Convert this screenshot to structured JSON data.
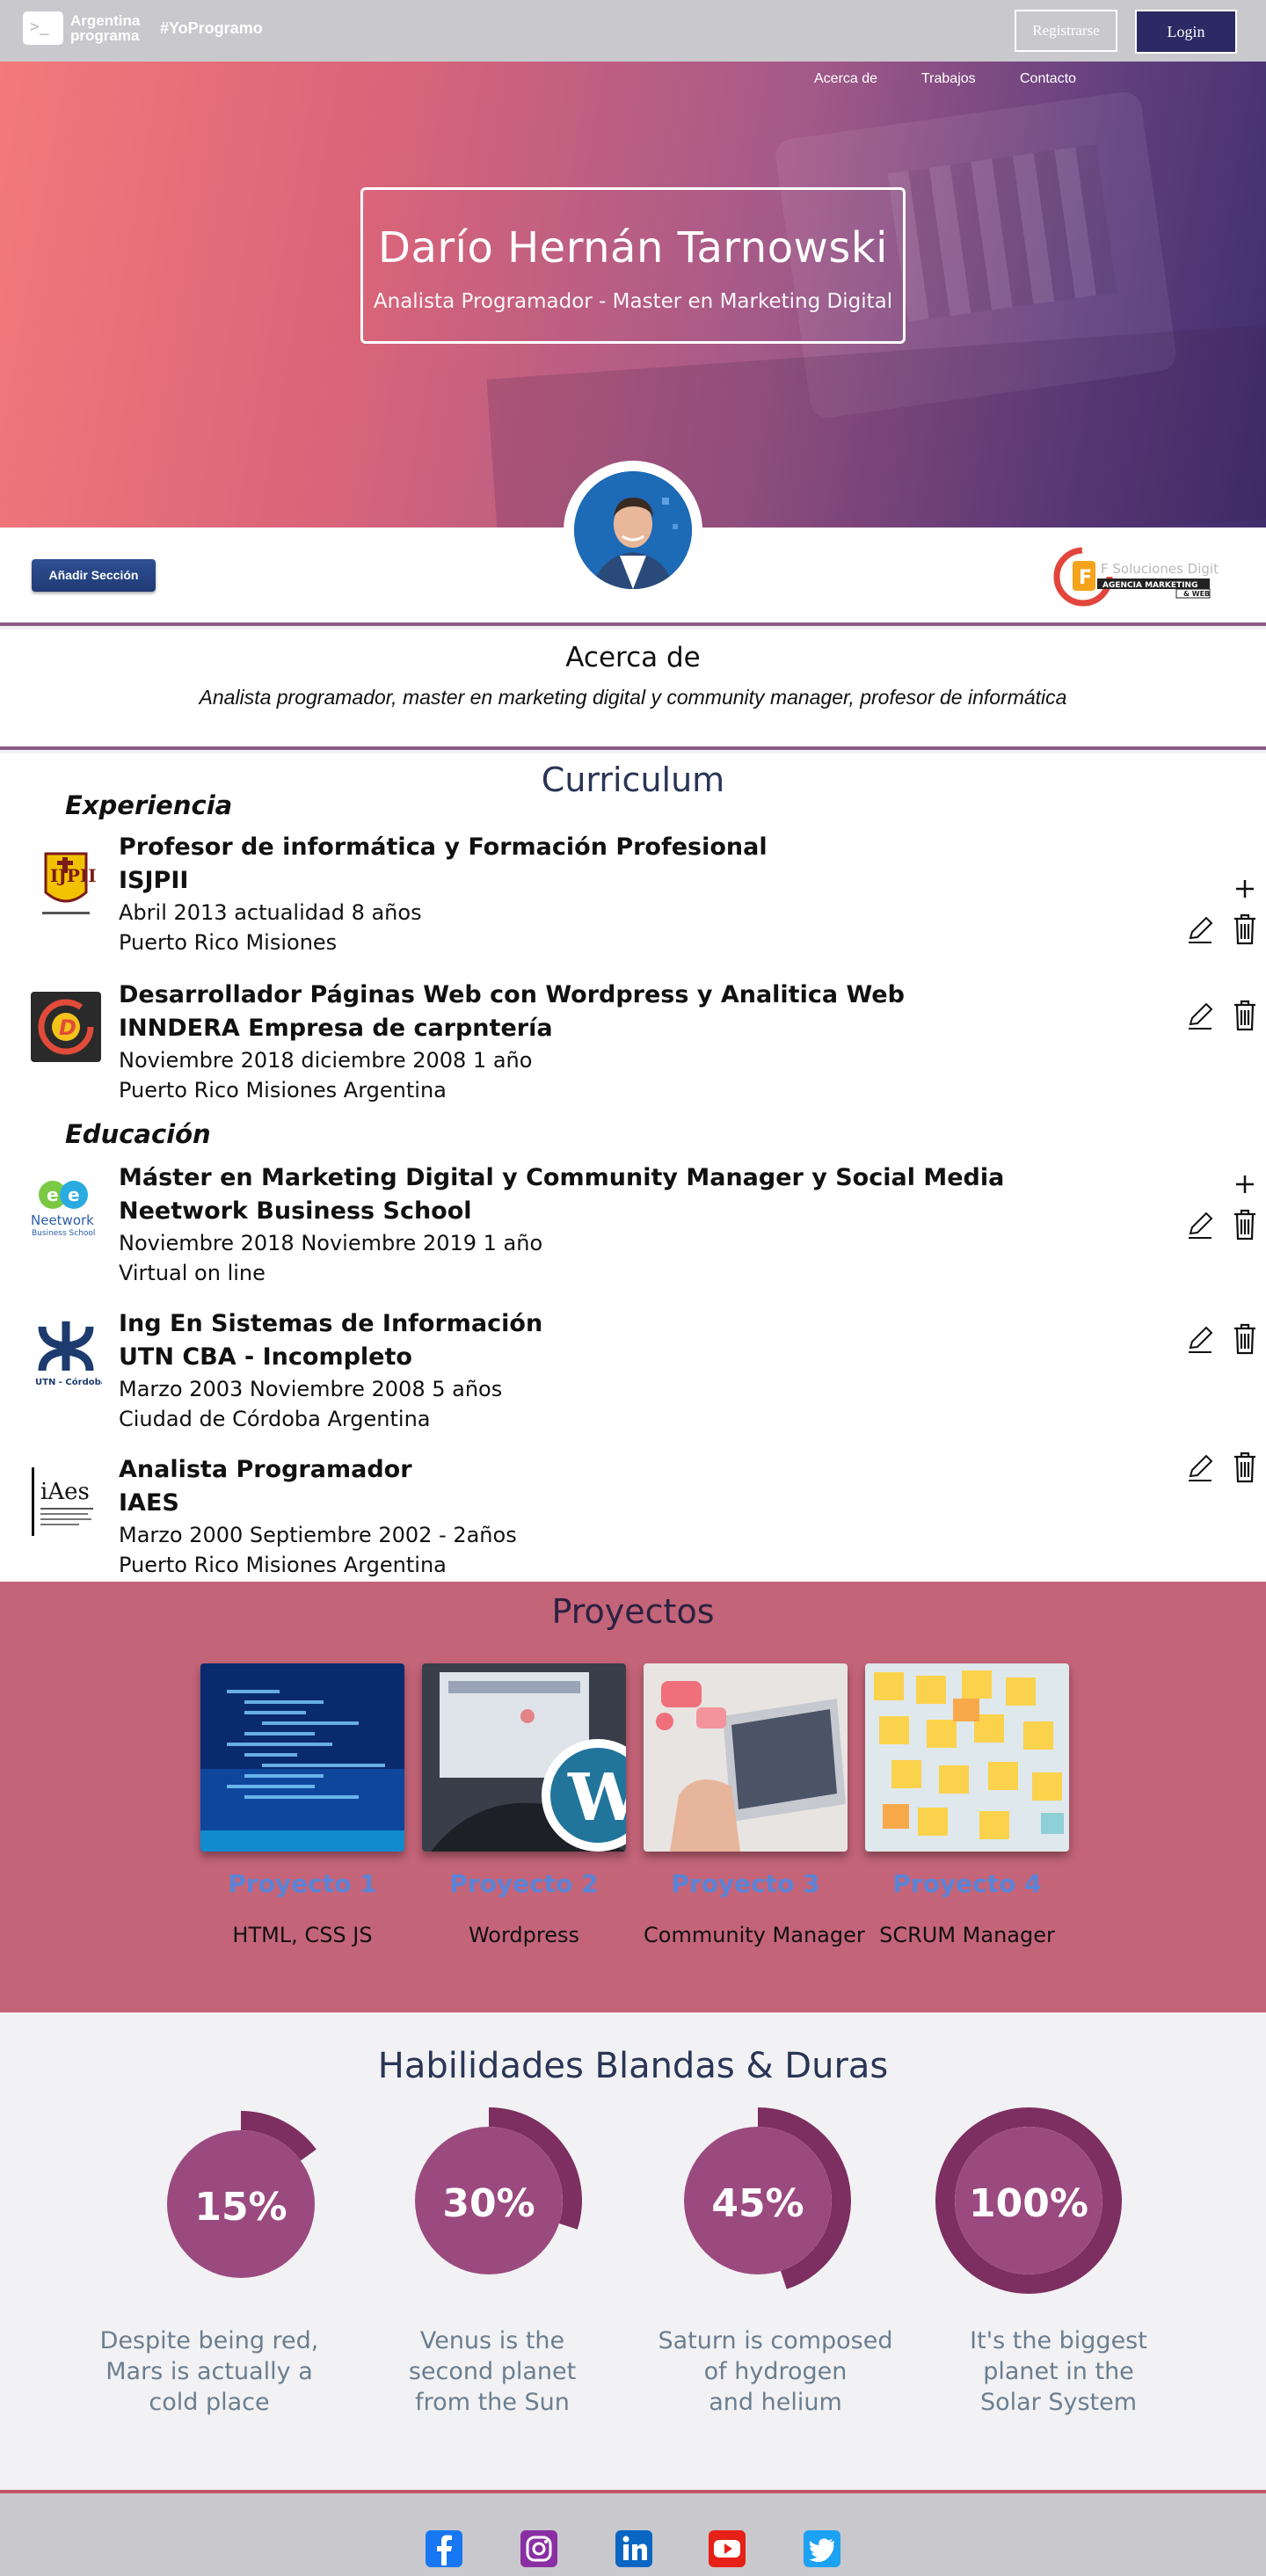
{
  "topbar": {
    "brand_line1": "Argentina",
    "brand_line2": "programa",
    "prompt_glyph": ">_",
    "hashtag": "#YoProgramo",
    "register_label": "Registrarse",
    "login_label": "Login"
  },
  "hero": {
    "nav": [
      "Acerca de",
      "Trabajos",
      "Contacto"
    ],
    "name": "Darío Hernán Tarnowski",
    "subtitle": "Analista Programador  - Master en  Marketing Digital"
  },
  "profile": {
    "add_section_label": "Añadir Sección",
    "sponsor_text_line1": "F Soluciones Digitales",
    "sponsor_text_line2": "AGENCIA MARKETING",
    "sponsor_text_line3": "& WEB"
  },
  "about": {
    "title": "Acerca de",
    "text": "Analista programador, master en marketing digital y community manager,  profesor de informática"
  },
  "curriculum": {
    "title": "Curriculum",
    "experience_heading": "Experiencia",
    "education_heading": "Educación",
    "experience": [
      {
        "title": "Profesor de informática  y Formación Profesional",
        "org": "ISJPII",
        "period": "Abril 2013  actualidad 8 años",
        "place": "Puerto Rico Misiones",
        "logo_text": "IJPII"
      },
      {
        "title": "Desarrollador Páginas Web con Wordpress y Analitica Web",
        "org": "INNDERA Empresa de carpntería",
        "period": "Noviembre 2018  diciembre 2008 1 año",
        "place": "Puerto Rico Misiones Argentina",
        "logo_text": "D"
      }
    ],
    "education": [
      {
        "title": "Máster en Marketing Digital y Community Manager y Social Media",
        "org": "Neetwork Business School",
        "period": "Noviembre  2018  Noviembre 2019 1 año",
        "place": "Virtual on line",
        "logo_text": "Neetwork",
        "logo_sub": "Business School"
      },
      {
        "title": "Ing En Sistemas de Información",
        "org": "UTN CBA - Incompleto",
        "period": "Marzo  2003  Noviembre 2008 5 años",
        "place": "Ciudad de Córdoba  Argentina",
        "logo_text": "UTN - Córdoba"
      },
      {
        "title": "Analista Programador",
        "org": "IAES",
        "period": "Marzo  2000  Septiembre 2002 - 2años",
        "place": "Puerto Rico Misiones Argentina",
        "logo_text": "iAes"
      }
    ]
  },
  "projects": {
    "title": "Proyectos",
    "items": [
      {
        "title": "Proyecto 1",
        "desc": "HTML, CSS JS"
      },
      {
        "title": "Proyecto 2",
        "desc": "Wordpress"
      },
      {
        "title": "Proyecto 3",
        "desc": "Community Manager"
      },
      {
        "title": "Proyecto  4",
        "desc": "SCRUM Manager"
      }
    ]
  },
  "skills": {
    "title": "Habilidades  Blandas & Duras",
    "items": [
      {
        "label": "15%",
        "value": 0.15,
        "desc": [
          "Despite being red,",
          "Mars is actually a",
          "cold place"
        ]
      },
      {
        "label": "30%",
        "value": 0.3,
        "desc": [
          "Venus is the",
          "second planet",
          "from the Sun"
        ]
      },
      {
        "label": "45%",
        "value": 0.45,
        "desc": [
          "Saturn is composed",
          "of hydrogen",
          "and helium"
        ]
      },
      {
        "label": "100%",
        "value": 1.0,
        "desc": [
          "It's the biggest",
          "planet in the",
          "Solar System"
        ]
      }
    ],
    "colors": {
      "inner": "#9b4a80",
      "ring": "#7c2f60"
    }
  },
  "footer": {
    "social": [
      "facebook-icon",
      "instagram-icon",
      "linkedin-icon",
      "youtube-icon",
      "twitter-icon"
    ]
  }
}
